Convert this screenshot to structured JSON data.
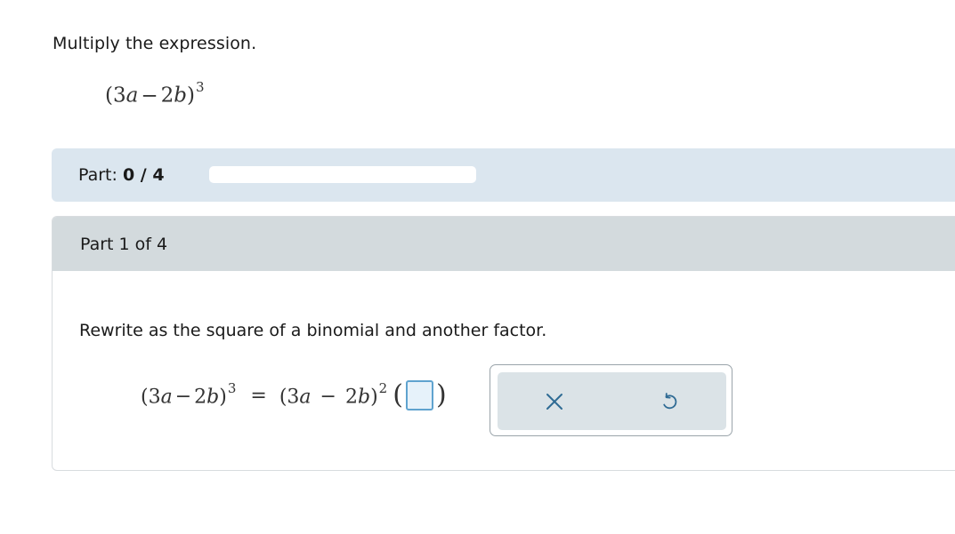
{
  "problem": {
    "instruction": "Multiply the expression.",
    "expression": {
      "open": "(3",
      "var1": "a",
      "minus": "−",
      "coef2": "2",
      "var2": "b",
      "close": ")",
      "exponent": "3"
    }
  },
  "progress": {
    "label": "Part:",
    "value": "0 / 4",
    "completed": 0,
    "total": 4
  },
  "part": {
    "title": "Part 1 of 4",
    "prompt": "Rewrite as the square of a binomial and another factor.",
    "equation": {
      "lhs_open": "(3",
      "lhs_var1": "a",
      "lhs_minus": "−",
      "lhs_coef2": "2",
      "lhs_var2": "b",
      "lhs_close": ")",
      "lhs_exponent": "3",
      "equals": "=",
      "rhs_open": "(3",
      "rhs_var1": "a",
      "rhs_minus": "−",
      "rhs_coef2": "2",
      "rhs_var2": "b",
      "rhs_close": ")",
      "rhs_exponent": "2",
      "factor_open": "(",
      "factor_close": ")",
      "answer_value": ""
    }
  },
  "tools": {
    "clear_icon": "close-icon",
    "undo_icon": "undo-icon",
    "icon_color": "#2f6b94"
  }
}
